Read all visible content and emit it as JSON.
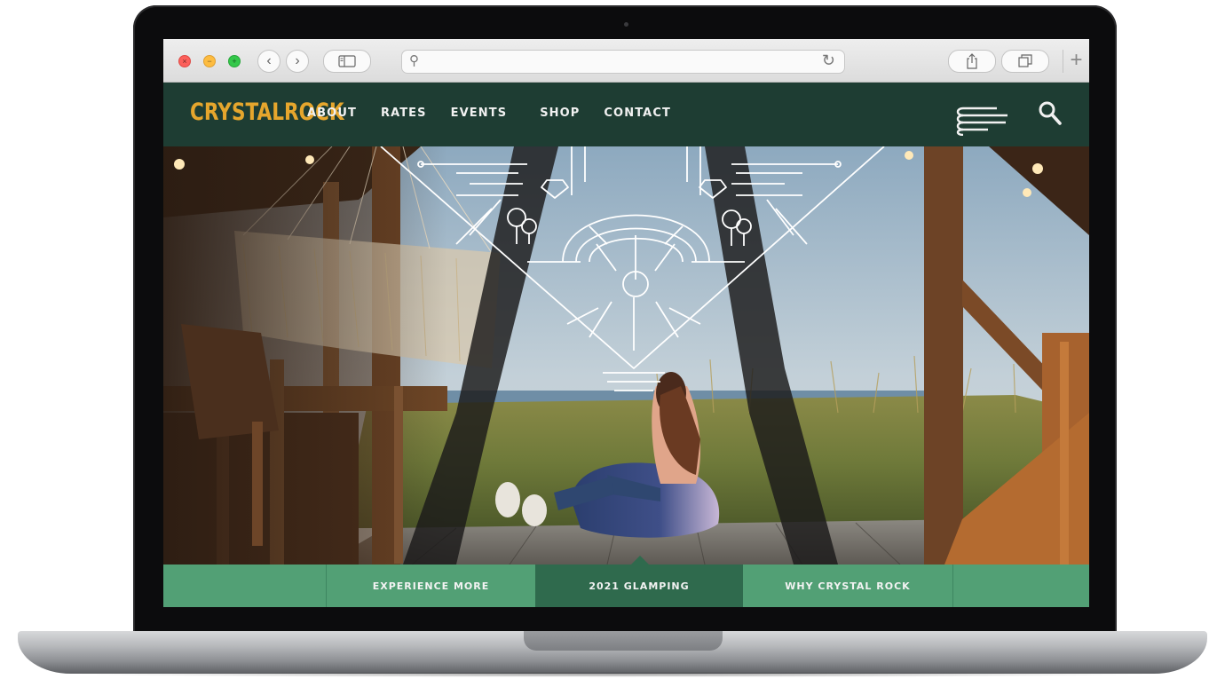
{
  "colors": {
    "header_bg": "#1e3d33",
    "logo": "#e6a62d",
    "tab_bar": "#52a075",
    "tab_active": "#2f6a4d"
  },
  "browser": {
    "address_value": "",
    "icons": [
      "close-icon",
      "minimize-icon",
      "zoom-icon",
      "back-icon",
      "forward-icon",
      "sidebar-icon",
      "search-icon",
      "reload-icon",
      "share-icon",
      "tabs-icon",
      "new-tab-icon"
    ]
  },
  "site": {
    "logo_text": "CrystalRock",
    "nav": [
      {
        "label": "ABOUT"
      },
      {
        "label": "RATES"
      },
      {
        "label": "EVENTS"
      },
      {
        "label": "SHOP"
      },
      {
        "label": "CONTACT"
      }
    ],
    "icons": [
      "menu-icon",
      "search-icon"
    ]
  },
  "tabs": [
    {
      "label": "EXPERIENCE MORE",
      "active": false
    },
    {
      "label": "2021 GLAMPING",
      "active": true
    },
    {
      "label": "WHY CRYSTAL ROCK",
      "active": false
    }
  ]
}
